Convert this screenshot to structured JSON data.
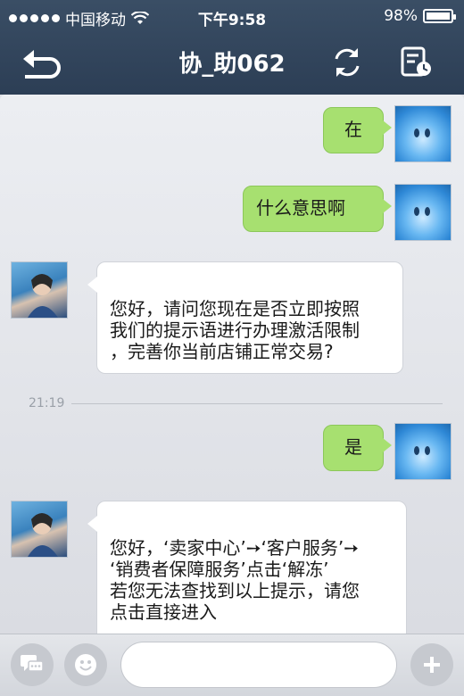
{
  "status_bar": {
    "carrier": "中国移动",
    "time": "下午9:58",
    "battery": "98%"
  },
  "nav": {
    "title": "协_助062",
    "back_icon": "back-arrow-icon",
    "refresh_icon": "refresh-icon",
    "history_icon": "chat-history-icon"
  },
  "messages": [
    {
      "direction": "out",
      "text": "在"
    },
    {
      "direction": "out",
      "text": "什么意思啊"
    },
    {
      "direction": "in",
      "lines": [
        "您好，请问您现在是否立即按照",
        "我们的提示语进行办理激活限制",
        "，完善你当前店铺正常交易?"
      ]
    },
    {
      "direction": "out",
      "text": "是"
    },
    {
      "direction": "in",
      "lines": [
        "您好，‘卖家中心’➙‘客户服务’➙",
        "‘销费者保障服务’点击‘解冻’",
        "若您无法查找到以上提示，请您",
        "点击直接进入"
      ]
    }
  ],
  "time_separator": "21:19",
  "input_bar": {
    "input_value": "",
    "left_icon": "quick-reply-icon",
    "emoji_icon": "emoji-icon",
    "plus_icon": "plus-icon"
  }
}
